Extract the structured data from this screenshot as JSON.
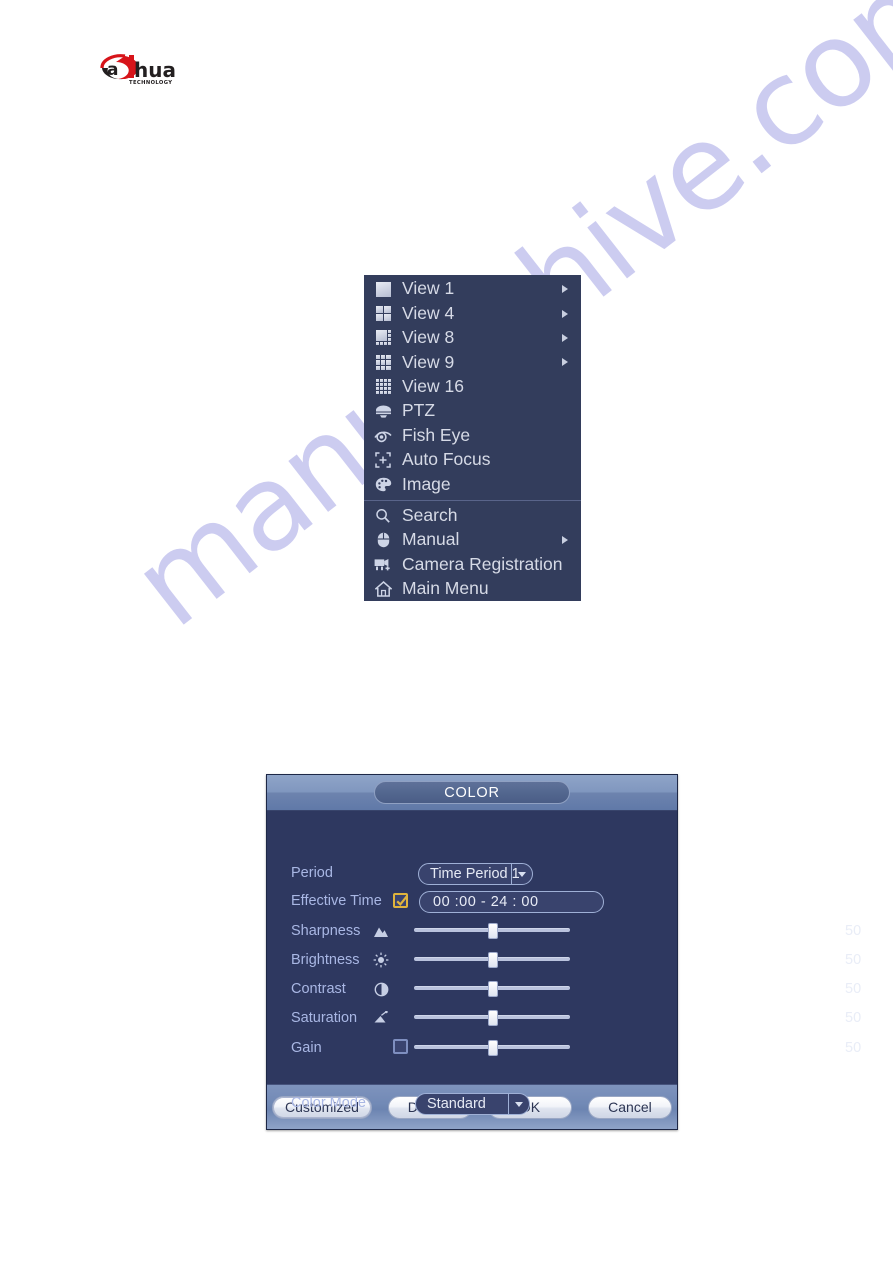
{
  "brand": {
    "name": "alhua",
    "tagline": "TECHNOLOGY"
  },
  "watermark": {
    "text": "manualshive.com"
  },
  "context_menu": {
    "items": [
      {
        "label": "View 1",
        "icon": "view-1-grid-icon",
        "submenu": true
      },
      {
        "label": "View 4",
        "icon": "view-4-grid-icon",
        "submenu": true
      },
      {
        "label": "View 8",
        "icon": "view-8-grid-icon",
        "submenu": true
      },
      {
        "label": "View 9",
        "icon": "view-9-grid-icon",
        "submenu": true
      },
      {
        "label": "View 16",
        "icon": "view-16-grid-icon",
        "submenu": false
      },
      {
        "label": "PTZ",
        "icon": "ptz-dome-icon",
        "submenu": false
      },
      {
        "label": "Fish Eye",
        "icon": "fisheye-icon",
        "submenu": false
      },
      {
        "label": "Auto Focus",
        "icon": "auto-focus-icon",
        "submenu": false
      },
      {
        "label": "Image",
        "icon": "palette-icon",
        "submenu": false
      },
      {
        "label": "Search",
        "icon": "search-icon",
        "submenu": false
      },
      {
        "label": "Manual",
        "icon": "mouse-icon",
        "submenu": true
      },
      {
        "label": "Camera Registration",
        "icon": "camera-add-icon",
        "submenu": false
      },
      {
        "label": "Main Menu",
        "icon": "home-icon",
        "submenu": false
      }
    ]
  },
  "color_dialog": {
    "title": "COLOR",
    "period": {
      "label": "Period",
      "value": "Time Period 1"
    },
    "effective_time": {
      "label": "Effective Time",
      "checked": true,
      "start_hour": "00",
      "start_min": "00",
      "separator": "-",
      "end_hour": "24",
      "end_min": "00",
      "display": "00 :00        - 24 : 00"
    },
    "sliders": [
      {
        "label": "Sharpness",
        "icon": "mountain-icon",
        "value": "50",
        "percent": 50,
        "has_checkbox": false
      },
      {
        "label": "Brightness",
        "icon": "sun-icon",
        "value": "50",
        "percent": 50,
        "has_checkbox": false
      },
      {
        "label": "Contrast",
        "icon": "half-circle-icon",
        "value": "50",
        "percent": 50,
        "has_checkbox": false
      },
      {
        "label": "Saturation",
        "icon": "paint-bucket-icon",
        "value": "50",
        "percent": 50,
        "has_checkbox": false
      },
      {
        "label": "Gain",
        "icon": "",
        "value": "50",
        "percent": 50,
        "has_checkbox": true,
        "checked": false
      }
    ],
    "color_mode": {
      "label": "Color Mode",
      "value": "Standard"
    },
    "buttons": [
      {
        "label": "Customized",
        "focused": true
      },
      {
        "label": "Default",
        "focused": false
      },
      {
        "label": "OK",
        "focused": false
      },
      {
        "label": "Cancel",
        "focused": false
      }
    ]
  }
}
